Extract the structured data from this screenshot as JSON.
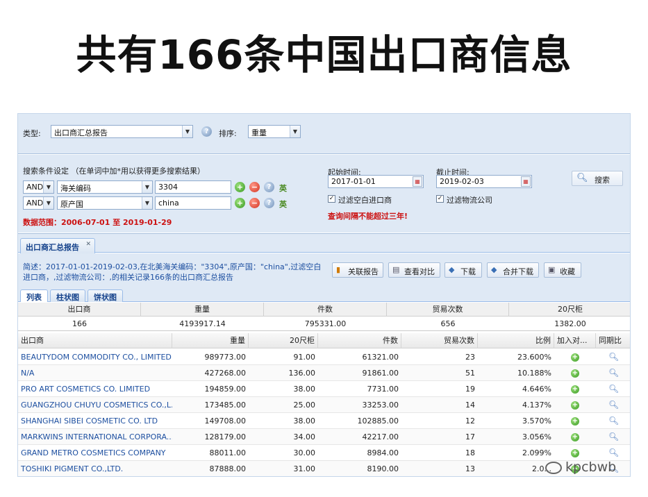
{
  "slide_title": "共有166条中国出口商信息",
  "filters": {
    "type_label": "类型:",
    "type_value": "出口商汇总报告",
    "sort_label": "排序:",
    "sort_value": "重量",
    "criteria_label": "搜索条件设定 （在单词中加*用以获得更多搜索结果）",
    "rows": [
      {
        "logic": "AND",
        "field": "海关编码",
        "value": "3304"
      },
      {
        "logic": "AND",
        "field": "原产国",
        "value": "china"
      }
    ],
    "ying": "英",
    "data_range": "数据范围：2006-07-01 至 2019-01-29",
    "start_label": "起始时间:",
    "start_value": "2017-01-01",
    "end_label": "截止时间:",
    "end_value": "2019-02-03",
    "filter_importer": "过滤空白进口商",
    "filter_logistics": "过滤物流公司",
    "interval_warning": "查询间隔不能超过三年!",
    "search_button": "搜索"
  },
  "tab": {
    "label": "出口商汇总报告",
    "close": "✕"
  },
  "summary": {
    "text": "简述：2017-01-01-2019-02-03,在北美海关编码：\"3304\",原产国：\"china\",过滤空白进口商，,过滤物流公司：,的相关记录166条的出口商汇总报告",
    "buttons": [
      "关联报告",
      "查看对比",
      "下载",
      "合并下载",
      "收藏"
    ]
  },
  "subtabs": [
    "列表",
    "柱状图",
    "饼状图"
  ],
  "totals": {
    "headers": [
      "出口商",
      "重量",
      "件数",
      "贸易次数",
      "20尺柜"
    ],
    "values": [
      "166",
      "4193917.14",
      "795331.00",
      "656",
      "1382.00"
    ]
  },
  "grid": {
    "headers": [
      "出口商",
      "重量",
      "20尺柜",
      "件数",
      "贸易次数",
      "比例",
      "加入对...",
      "同期比"
    ],
    "rows": [
      {
        "name": "BEAUTYDOM COMMODITY CO., LIMITED",
        "weight": "989773.00",
        "teu": "91.00",
        "pieces": "61321.00",
        "trades": "23",
        "ratio": "23.600%"
      },
      {
        "name": "N/A",
        "weight": "427268.00",
        "teu": "136.00",
        "pieces": "91861.00",
        "trades": "51",
        "ratio": "10.188%"
      },
      {
        "name": "PRO ART COSMETICS CO. LIMITED",
        "weight": "194859.00",
        "teu": "38.00",
        "pieces": "7731.00",
        "trades": "19",
        "ratio": "4.646%"
      },
      {
        "name": "GUANGZHOU CHUYU COSMETICS CO.,L...",
        "weight": "173485.00",
        "teu": "25.00",
        "pieces": "33253.00",
        "trades": "14",
        "ratio": "4.137%"
      },
      {
        "name": "SHANGHAI SIBEI COSMETIC CO. LTD",
        "weight": "149708.00",
        "teu": "38.00",
        "pieces": "102885.00",
        "trades": "12",
        "ratio": "3.570%"
      },
      {
        "name": "MARKWINS INTERNATIONAL CORPORA...",
        "weight": "128179.00",
        "teu": "34.00",
        "pieces": "42217.00",
        "trades": "17",
        "ratio": "3.056%"
      },
      {
        "name": "GRAND METRO COSMETICS COMPANY",
        "weight": "88011.00",
        "teu": "30.00",
        "pieces": "8984.00",
        "trades": "18",
        "ratio": "2.099%"
      },
      {
        "name": "TOSHIKI PIGMENT CO.,LTD.",
        "weight": "87888.00",
        "teu": "31.00",
        "pieces": "8190.00",
        "trades": "13",
        "ratio": "2.0..."
      }
    ]
  },
  "watermark": "kpcbwb"
}
